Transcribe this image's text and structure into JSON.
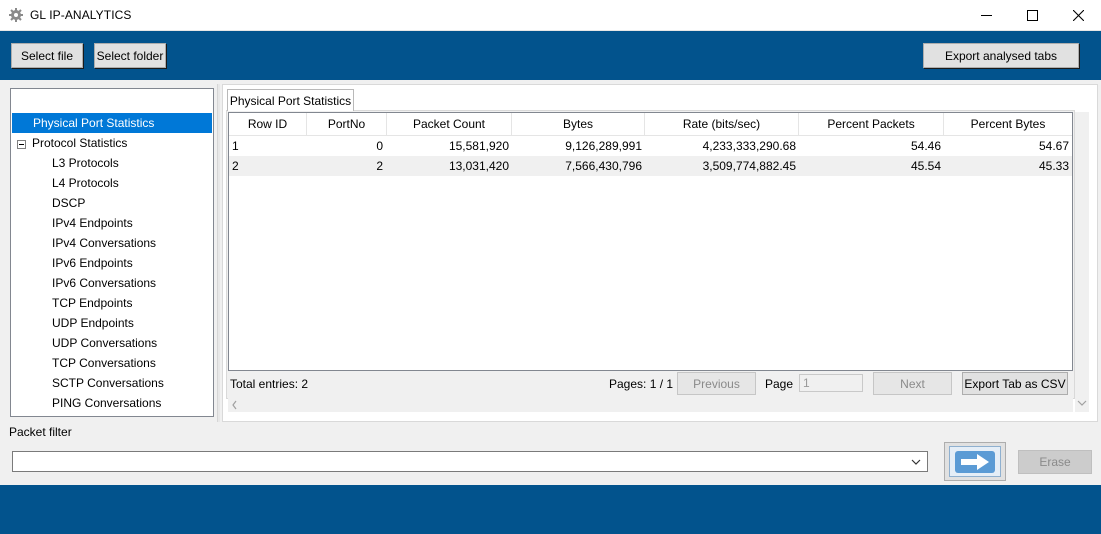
{
  "window": {
    "title": "GL IP-ANALYTICS",
    "icon": "gear-icon"
  },
  "toolbar": {
    "select_file": "Select file",
    "select_folder": "Select folder",
    "export_analysed": "Export analysed tabs"
  },
  "tree": {
    "items": [
      {
        "label": "Physical Port Statistics",
        "selected": true
      },
      {
        "label": "Protocol Statistics",
        "expanded": true
      },
      {
        "label": "L3 Protocols"
      },
      {
        "label": "L4 Protocols"
      },
      {
        "label": "DSCP"
      },
      {
        "label": "IPv4 Endpoints"
      },
      {
        "label": "IPv4 Conversations"
      },
      {
        "label": "IPv6 Endpoints"
      },
      {
        "label": "IPv6 Conversations"
      },
      {
        "label": "TCP Endpoints"
      },
      {
        "label": "UDP Endpoints"
      },
      {
        "label": "UDP Conversations"
      },
      {
        "label": "TCP Conversations"
      },
      {
        "label": "SCTP Conversations"
      },
      {
        "label": "PING Conversations"
      }
    ]
  },
  "tab": {
    "label": "Physical Port Statistics"
  },
  "table": {
    "columns": [
      "Row ID",
      "PortNo",
      "Packet Count",
      "Bytes",
      "Rate (bits/sec)",
      "Percent Packets",
      "Percent Bytes"
    ],
    "rows": [
      [
        "1",
        "0",
        "15,581,920",
        "9,126,289,991",
        "4,233,333,290.68",
        "54.46",
        "54.67"
      ],
      [
        "2",
        "2",
        "13,031,420",
        "7,566,430,796",
        "3,509,774,882.45",
        "45.54",
        "45.33"
      ]
    ]
  },
  "pager": {
    "total_entries": "Total entries: 2",
    "pages": "Pages: 1 / 1",
    "previous": "Previous",
    "page_label": "Page",
    "page_value": "1",
    "next": "Next",
    "export_csv": "Export Tab as CSV"
  },
  "filter": {
    "label": "Packet filter",
    "value": "",
    "apply_icon": "arrow-right-icon",
    "erase": "Erase"
  },
  "colors": {
    "brand_blue": "#02538d",
    "selection": "#0078d7"
  }
}
